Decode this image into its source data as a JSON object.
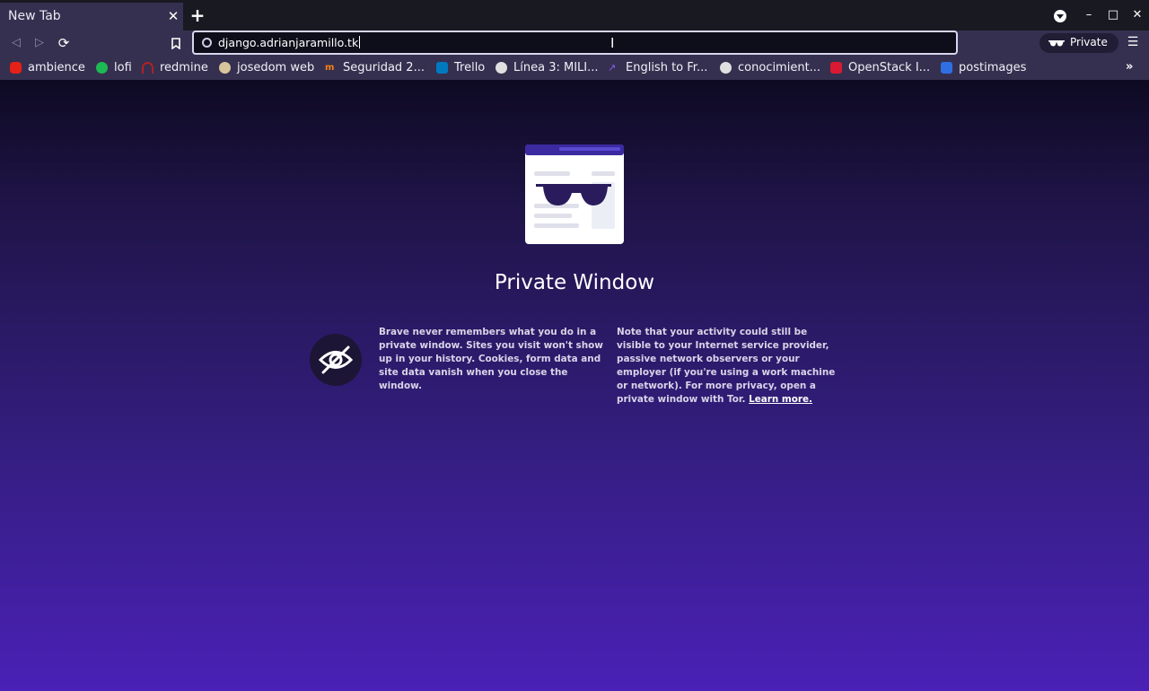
{
  "tab": {
    "title": "New Tab",
    "close": "✕",
    "new_tab": "+"
  },
  "window": {
    "minimize": "–",
    "maximize": "□",
    "close": "✕"
  },
  "toolbar": {
    "back": "◁",
    "forward": "▷",
    "reload": "⟳",
    "bookmark": "🔖",
    "url": "django.adrianjaramillo.tk",
    "private_label": "Private",
    "menu": "☰"
  },
  "bookmarks": [
    {
      "label": "ambience",
      "icon": "youtube-icon",
      "color": "#e62117"
    },
    {
      "label": "lofi",
      "icon": "spotify-icon",
      "color": "#1db954"
    },
    {
      "label": "redmine",
      "icon": "redmine-icon",
      "color": "#b32024"
    },
    {
      "label": "josedom web",
      "icon": "avatar-icon",
      "color": "#d8c49a"
    },
    {
      "label": "Seguridad 2...",
      "icon": "moodle-icon",
      "color": "#f98012"
    },
    {
      "label": "Trello",
      "icon": "trello-icon",
      "color": "#0079bf"
    },
    {
      "label": "Línea 3: MILI...",
      "icon": "globe-icon",
      "color": "#e0e0e0"
    },
    {
      "label": "English to Fr...",
      "icon": "translate-icon",
      "color": "#8a5cf6"
    },
    {
      "label": "conocimient...",
      "icon": "tux-icon",
      "color": "#e0e0e0"
    },
    {
      "label": "OpenStack I...",
      "icon": "openstack-icon",
      "color": "#da1a32"
    },
    {
      "label": "postimages",
      "icon": "postimages-icon",
      "color": "#2f6fe4"
    }
  ],
  "bookmarks_more": "»",
  "page": {
    "title": "Private Window",
    "left_text": "Brave never remembers what you do in a private window. Sites you visit won't show up in your history. Cookies, form data and site data vanish when you close the window.",
    "right_text": "Note that your activity could still be visible to your Internet service provider, passive network observers or your employer (if you're using a work machine or network). For more privacy, open a private window with Tor.",
    "learn_more": "Learn more."
  },
  "colors": {
    "accent": "#4a20b6",
    "toolbar": "#35304f",
    "tabstrip": "#191922"
  }
}
